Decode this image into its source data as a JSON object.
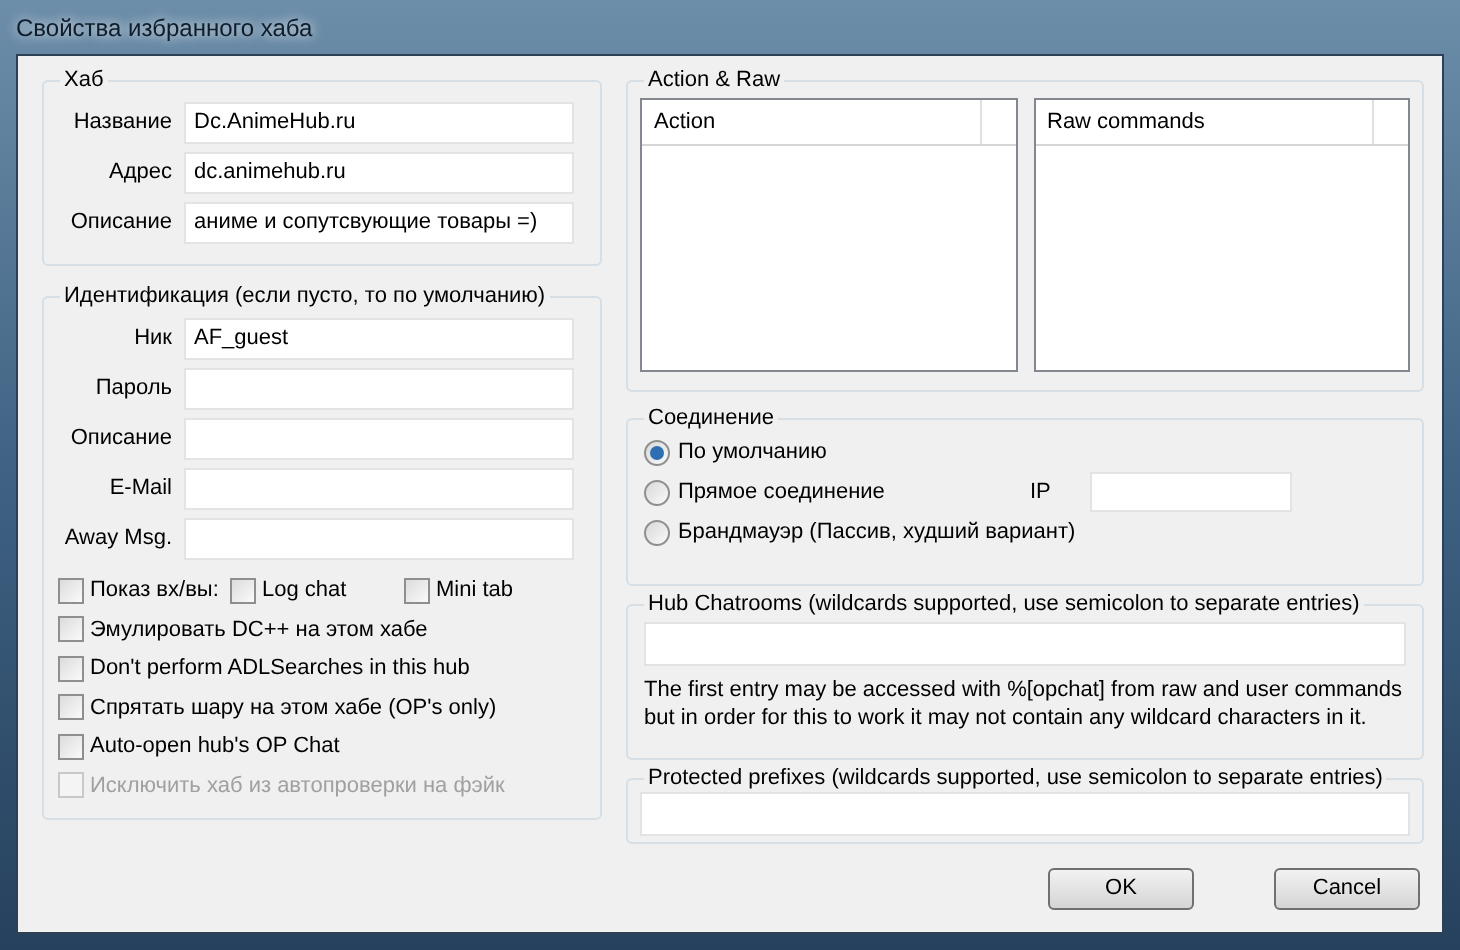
{
  "window": {
    "title": "Свойства избранного хаба"
  },
  "hub_group": {
    "title": "Хаб",
    "fields": [
      {
        "label": "Название",
        "value": "Dc.AnimeHub.ru"
      },
      {
        "label": "Адрес",
        "value": "dc.animehub.ru"
      },
      {
        "label": "Описание",
        "value": "аниме и сопутсвующие товары =)"
      }
    ]
  },
  "identity_group": {
    "title": "Идентификация (если пусто, то по умолчанию)",
    "fields": [
      {
        "label": "Ник",
        "value": "AF_guest"
      },
      {
        "label": "Пароль"
      },
      {
        "label": "Описание"
      },
      {
        "label": "E-Mail"
      },
      {
        "label": "Away Msg."
      }
    ],
    "checkbox_rows": [
      {
        "items": [
          {
            "label": "Показ вх/вы:",
            "checked": false,
            "disabled": false
          },
          {
            "label": "Log chat",
            "checked": false,
            "disabled": false
          },
          {
            "label": "Mini tab",
            "checked": false,
            "disabled": false
          }
        ]
      },
      {
        "items": [
          {
            "label": "Эмулировать DC++ на этом хабе",
            "checked": false,
            "disabled": false
          }
        ]
      },
      {
        "items": [
          {
            "label": "Don't perform ADLSearches in this hub",
            "checked": false,
            "disabled": false
          }
        ]
      },
      {
        "items": [
          {
            "label": "Спрятать шару на этом хабе (OP's only)",
            "checked": false,
            "disabled": false
          }
        ]
      },
      {
        "items": [
          {
            "label": "Auto-open hub's OP Chat",
            "checked": false,
            "disabled": false
          }
        ]
      },
      {
        "items": [
          {
            "label": "Исключить хаб из автопроверки на фэйк",
            "checked": false,
            "disabled": true
          }
        ]
      }
    ]
  },
  "action_raw": {
    "title": "Action & Raw",
    "lists": [
      {
        "column": "Action"
      },
      {
        "column": "Raw commands"
      }
    ]
  },
  "connection": {
    "title": "Соединение",
    "options": [
      {
        "label": "По умолчанию",
        "selected": true
      },
      {
        "label": "Прямое соединение",
        "selected": false
      },
      {
        "label": "Брандмауэр (Пассив, худший вариант)",
        "selected": false
      }
    ],
    "ip_label": "IP"
  },
  "hub_chatrooms": {
    "title": "Hub Chatrooms (wildcards supported, use semicolon to separate entries)",
    "note": "The first entry may be accessed with %[opchat] from raw and user commands but in order for this to work it may not contain any wildcard characters in it."
  },
  "protected_prefixes": {
    "title": "Protected prefixes (wildcards supported, use semicolon to separate entries)"
  },
  "buttons": [
    "OK",
    "Cancel"
  ]
}
